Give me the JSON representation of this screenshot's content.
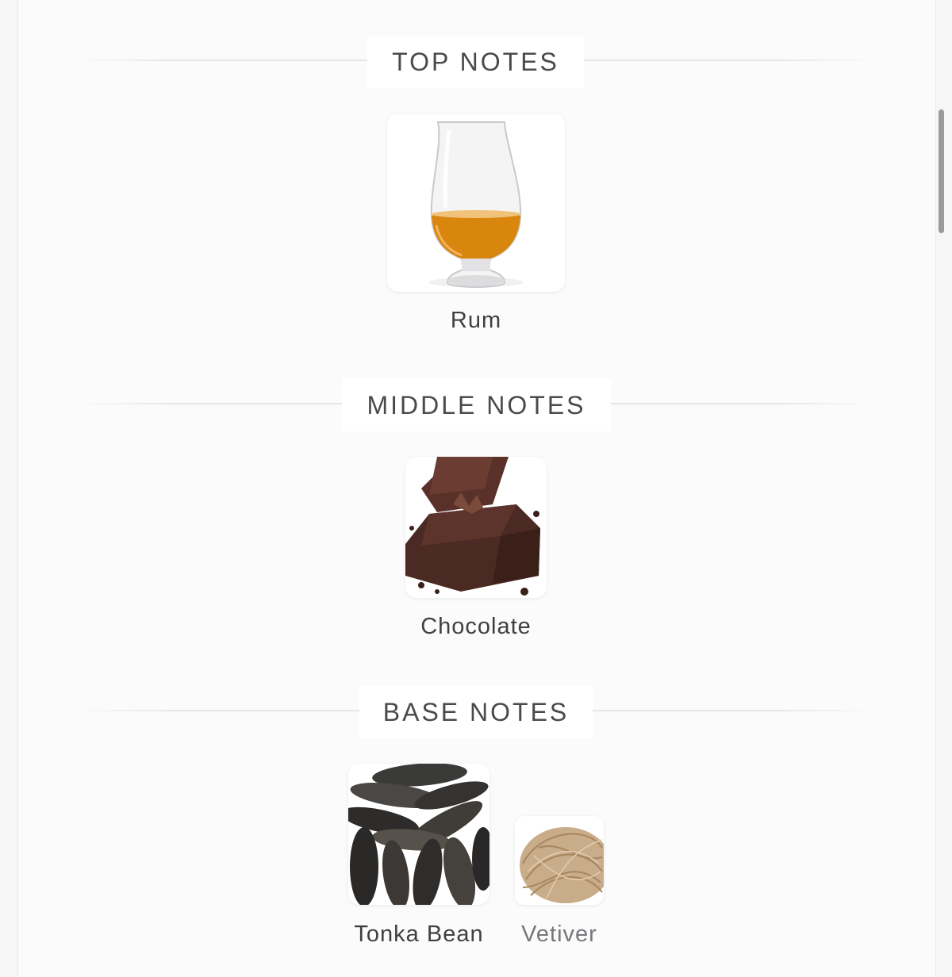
{
  "sections": [
    {
      "title": "TOP NOTES",
      "notes": [
        {
          "label": "Rum",
          "icon": "rum-glass-icon"
        }
      ]
    },
    {
      "title": "MIDDLE NOTES",
      "notes": [
        {
          "label": "Chocolate",
          "icon": "chocolate-icon"
        }
      ]
    },
    {
      "title": "BASE NOTES",
      "notes": [
        {
          "label": "Tonka Bean",
          "icon": "tonka-bean-icon"
        },
        {
          "label": "Vetiver",
          "icon": "vetiver-icon"
        }
      ]
    }
  ],
  "colors": {
    "title_text": "#4a4a4e",
    "label_text": "#3f3f44",
    "rum": "#d9860f",
    "chocolate": "#4a2a22"
  }
}
